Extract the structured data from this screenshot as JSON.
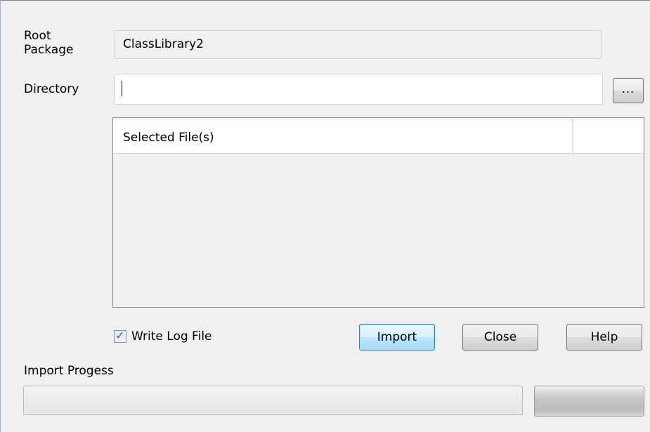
{
  "form": {
    "root_package_label": "Root\nPackage",
    "root_package_value": "ClassLibrary2",
    "directory_label": "Directory",
    "directory_value": "",
    "browse_label": "...",
    "file_list": {
      "columns": [
        "Selected File(s)",
        ""
      ],
      "rows": []
    },
    "write_log_label": "Write Log File",
    "write_log_checked": true,
    "import_label": "Import",
    "close_label": "Close",
    "help_label": "Help",
    "progress_label": "Import Progess",
    "progress_value": 0
  },
  "colors": {
    "dialog_bg": "#f0f0f0",
    "default_button_border": "#3c7fb1",
    "list_border": "#828790",
    "progress_fill": "#06b025"
  }
}
